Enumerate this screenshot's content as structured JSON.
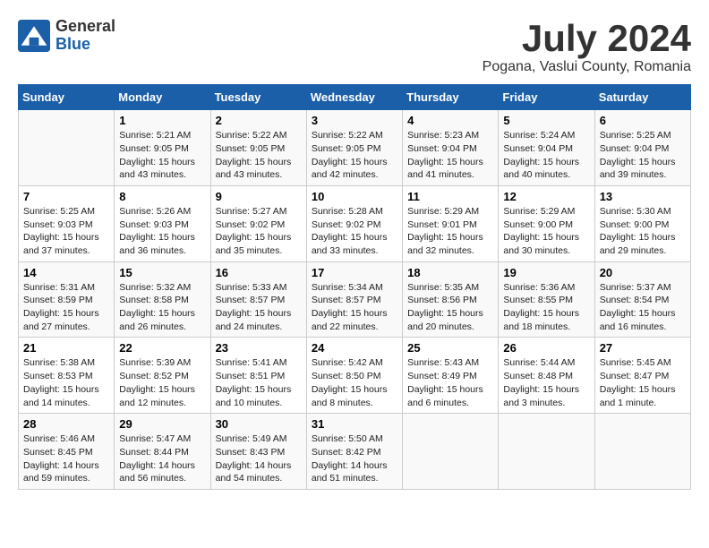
{
  "header": {
    "logo_general": "General",
    "logo_blue": "Blue",
    "month_title": "July 2024",
    "location": "Pogana, Vaslui County, Romania"
  },
  "weekdays": [
    "Sunday",
    "Monday",
    "Tuesday",
    "Wednesday",
    "Thursday",
    "Friday",
    "Saturday"
  ],
  "weeks": [
    [
      {
        "day": "",
        "info": ""
      },
      {
        "day": "1",
        "info": "Sunrise: 5:21 AM\nSunset: 9:05 PM\nDaylight: 15 hours\nand 43 minutes."
      },
      {
        "day": "2",
        "info": "Sunrise: 5:22 AM\nSunset: 9:05 PM\nDaylight: 15 hours\nand 43 minutes."
      },
      {
        "day": "3",
        "info": "Sunrise: 5:22 AM\nSunset: 9:05 PM\nDaylight: 15 hours\nand 42 minutes."
      },
      {
        "day": "4",
        "info": "Sunrise: 5:23 AM\nSunset: 9:04 PM\nDaylight: 15 hours\nand 41 minutes."
      },
      {
        "day": "5",
        "info": "Sunrise: 5:24 AM\nSunset: 9:04 PM\nDaylight: 15 hours\nand 40 minutes."
      },
      {
        "day": "6",
        "info": "Sunrise: 5:25 AM\nSunset: 9:04 PM\nDaylight: 15 hours\nand 39 minutes."
      }
    ],
    [
      {
        "day": "7",
        "info": "Sunrise: 5:25 AM\nSunset: 9:03 PM\nDaylight: 15 hours\nand 37 minutes."
      },
      {
        "day": "8",
        "info": "Sunrise: 5:26 AM\nSunset: 9:03 PM\nDaylight: 15 hours\nand 36 minutes."
      },
      {
        "day": "9",
        "info": "Sunrise: 5:27 AM\nSunset: 9:02 PM\nDaylight: 15 hours\nand 35 minutes."
      },
      {
        "day": "10",
        "info": "Sunrise: 5:28 AM\nSunset: 9:02 PM\nDaylight: 15 hours\nand 33 minutes."
      },
      {
        "day": "11",
        "info": "Sunrise: 5:29 AM\nSunset: 9:01 PM\nDaylight: 15 hours\nand 32 minutes."
      },
      {
        "day": "12",
        "info": "Sunrise: 5:29 AM\nSunset: 9:00 PM\nDaylight: 15 hours\nand 30 minutes."
      },
      {
        "day": "13",
        "info": "Sunrise: 5:30 AM\nSunset: 9:00 PM\nDaylight: 15 hours\nand 29 minutes."
      }
    ],
    [
      {
        "day": "14",
        "info": "Sunrise: 5:31 AM\nSunset: 8:59 PM\nDaylight: 15 hours\nand 27 minutes."
      },
      {
        "day": "15",
        "info": "Sunrise: 5:32 AM\nSunset: 8:58 PM\nDaylight: 15 hours\nand 26 minutes."
      },
      {
        "day": "16",
        "info": "Sunrise: 5:33 AM\nSunset: 8:57 PM\nDaylight: 15 hours\nand 24 minutes."
      },
      {
        "day": "17",
        "info": "Sunrise: 5:34 AM\nSunset: 8:57 PM\nDaylight: 15 hours\nand 22 minutes."
      },
      {
        "day": "18",
        "info": "Sunrise: 5:35 AM\nSunset: 8:56 PM\nDaylight: 15 hours\nand 20 minutes."
      },
      {
        "day": "19",
        "info": "Sunrise: 5:36 AM\nSunset: 8:55 PM\nDaylight: 15 hours\nand 18 minutes."
      },
      {
        "day": "20",
        "info": "Sunrise: 5:37 AM\nSunset: 8:54 PM\nDaylight: 15 hours\nand 16 minutes."
      }
    ],
    [
      {
        "day": "21",
        "info": "Sunrise: 5:38 AM\nSunset: 8:53 PM\nDaylight: 15 hours\nand 14 minutes."
      },
      {
        "day": "22",
        "info": "Sunrise: 5:39 AM\nSunset: 8:52 PM\nDaylight: 15 hours\nand 12 minutes."
      },
      {
        "day": "23",
        "info": "Sunrise: 5:41 AM\nSunset: 8:51 PM\nDaylight: 15 hours\nand 10 minutes."
      },
      {
        "day": "24",
        "info": "Sunrise: 5:42 AM\nSunset: 8:50 PM\nDaylight: 15 hours\nand 8 minutes."
      },
      {
        "day": "25",
        "info": "Sunrise: 5:43 AM\nSunset: 8:49 PM\nDaylight: 15 hours\nand 6 minutes."
      },
      {
        "day": "26",
        "info": "Sunrise: 5:44 AM\nSunset: 8:48 PM\nDaylight: 15 hours\nand 3 minutes."
      },
      {
        "day": "27",
        "info": "Sunrise: 5:45 AM\nSunset: 8:47 PM\nDaylight: 15 hours\nand 1 minute."
      }
    ],
    [
      {
        "day": "28",
        "info": "Sunrise: 5:46 AM\nSunset: 8:45 PM\nDaylight: 14 hours\nand 59 minutes."
      },
      {
        "day": "29",
        "info": "Sunrise: 5:47 AM\nSunset: 8:44 PM\nDaylight: 14 hours\nand 56 minutes."
      },
      {
        "day": "30",
        "info": "Sunrise: 5:49 AM\nSunset: 8:43 PM\nDaylight: 14 hours\nand 54 minutes."
      },
      {
        "day": "31",
        "info": "Sunrise: 5:50 AM\nSunset: 8:42 PM\nDaylight: 14 hours\nand 51 minutes."
      },
      {
        "day": "",
        "info": ""
      },
      {
        "day": "",
        "info": ""
      },
      {
        "day": "",
        "info": ""
      }
    ]
  ]
}
